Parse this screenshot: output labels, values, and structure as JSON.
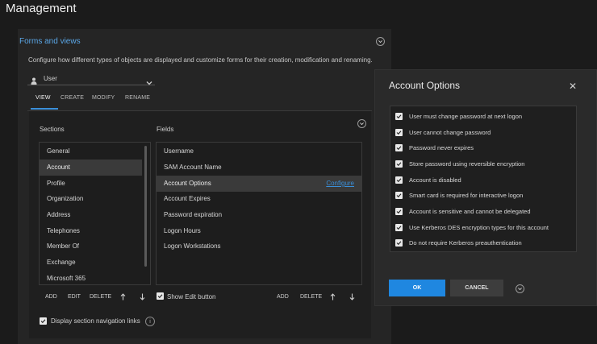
{
  "page_title": "Management",
  "panel": {
    "title": "Forms and views",
    "description": "Configure how different types of objects are displayed and customize forms for their creation, modification and renaming.",
    "object_type": "User"
  },
  "tabs": [
    {
      "label": "VIEW",
      "active": true
    },
    {
      "label": "CREATE",
      "active": false
    },
    {
      "label": "MODIFY",
      "active": false
    },
    {
      "label": "RENAME",
      "active": false
    }
  ],
  "sections": {
    "header": "Sections",
    "items": [
      "General",
      "Account",
      "Profile",
      "Organization",
      "Address",
      "Telephones",
      "Member Of",
      "Exchange",
      "Microsoft 365"
    ],
    "selected_index": 1,
    "buttons": {
      "add": "ADD",
      "edit": "EDIT",
      "delete": "DELETE"
    }
  },
  "fields": {
    "header": "Fields",
    "items": [
      "Username",
      "SAM Account Name",
      "Account Options",
      "Account Expires",
      "Password expiration",
      "Logon Hours",
      "Logon Workstations"
    ],
    "selected_index": 2,
    "configure_label": "Configure",
    "show_edit_label": "Show Edit button",
    "buttons": {
      "add": "ADD",
      "delete": "DELETE"
    }
  },
  "display_nav_links_label": "Display section navigation links",
  "dialog": {
    "title": "Account Options",
    "options": [
      "User must change password at next logon",
      "User cannot change password",
      "Password never expires",
      "Store password using reversible encryption",
      "Account is disabled",
      "Smart card is required for interactive logon",
      "Account is sensitive and cannot be delegated",
      "Use Kerberos DES encryption types for this account",
      "Do not require Kerberos preauthentication"
    ],
    "ok_label": "OK",
    "cancel_label": "CANCEL"
  },
  "colors": {
    "accent": "#1f87e0",
    "link": "#5aa6e6",
    "background": "#1b1b1b"
  }
}
